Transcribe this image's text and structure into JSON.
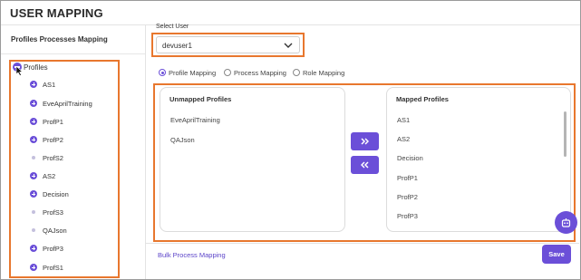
{
  "header": {
    "title": "USER MAPPING"
  },
  "left_panel": {
    "title": "Profiles Processes Mapping",
    "root": {
      "label": "Profiles",
      "icon": "minus-circle-icon"
    },
    "items": [
      {
        "label": "AS1",
        "icon": "plus-circle-icon"
      },
      {
        "label": "EveAprilTraining",
        "icon": "plus-circle-icon"
      },
      {
        "label": "ProfP1",
        "icon": "plus-circle-icon"
      },
      {
        "label": "ProfP2",
        "icon": "plus-circle-icon"
      },
      {
        "label": "ProfS2",
        "icon": "dot-icon"
      },
      {
        "label": "AS2",
        "icon": "plus-circle-icon"
      },
      {
        "label": "Decision",
        "icon": "plus-circle-icon"
      },
      {
        "label": "ProfS3",
        "icon": "dot-icon"
      },
      {
        "label": "QAJson",
        "icon": "dot-icon"
      },
      {
        "label": "ProfP3",
        "icon": "plus-circle-icon"
      },
      {
        "label": "ProfS1",
        "icon": "plus-circle-icon"
      }
    ]
  },
  "select_user": {
    "label": "Select User",
    "value": "devuser1",
    "icon": "chevron-down-icon"
  },
  "mapping_type": {
    "options": [
      "Profile Mapping",
      "Process Mapping",
      "Role Mapping"
    ],
    "selected": "Profile Mapping"
  },
  "unmapped": {
    "title": "Unmapped Profiles",
    "rows": [
      "EveAprilTraining",
      "QAJson"
    ]
  },
  "mapped": {
    "title": "Mapped Profiles",
    "rows": [
      "AS1",
      "AS2",
      "Decision",
      "ProfP1",
      "ProfP2",
      "ProfP3"
    ]
  },
  "transfer": {
    "move_right_icon": "double-chevron-right-icon",
    "move_left_icon": "double-chevron-left-icon"
  },
  "footer": {
    "bulk_link": "Bulk Process Mapping",
    "save_label": "Save"
  },
  "colors": {
    "accent": "#6b4fd8",
    "highlight": "#e8772e"
  }
}
